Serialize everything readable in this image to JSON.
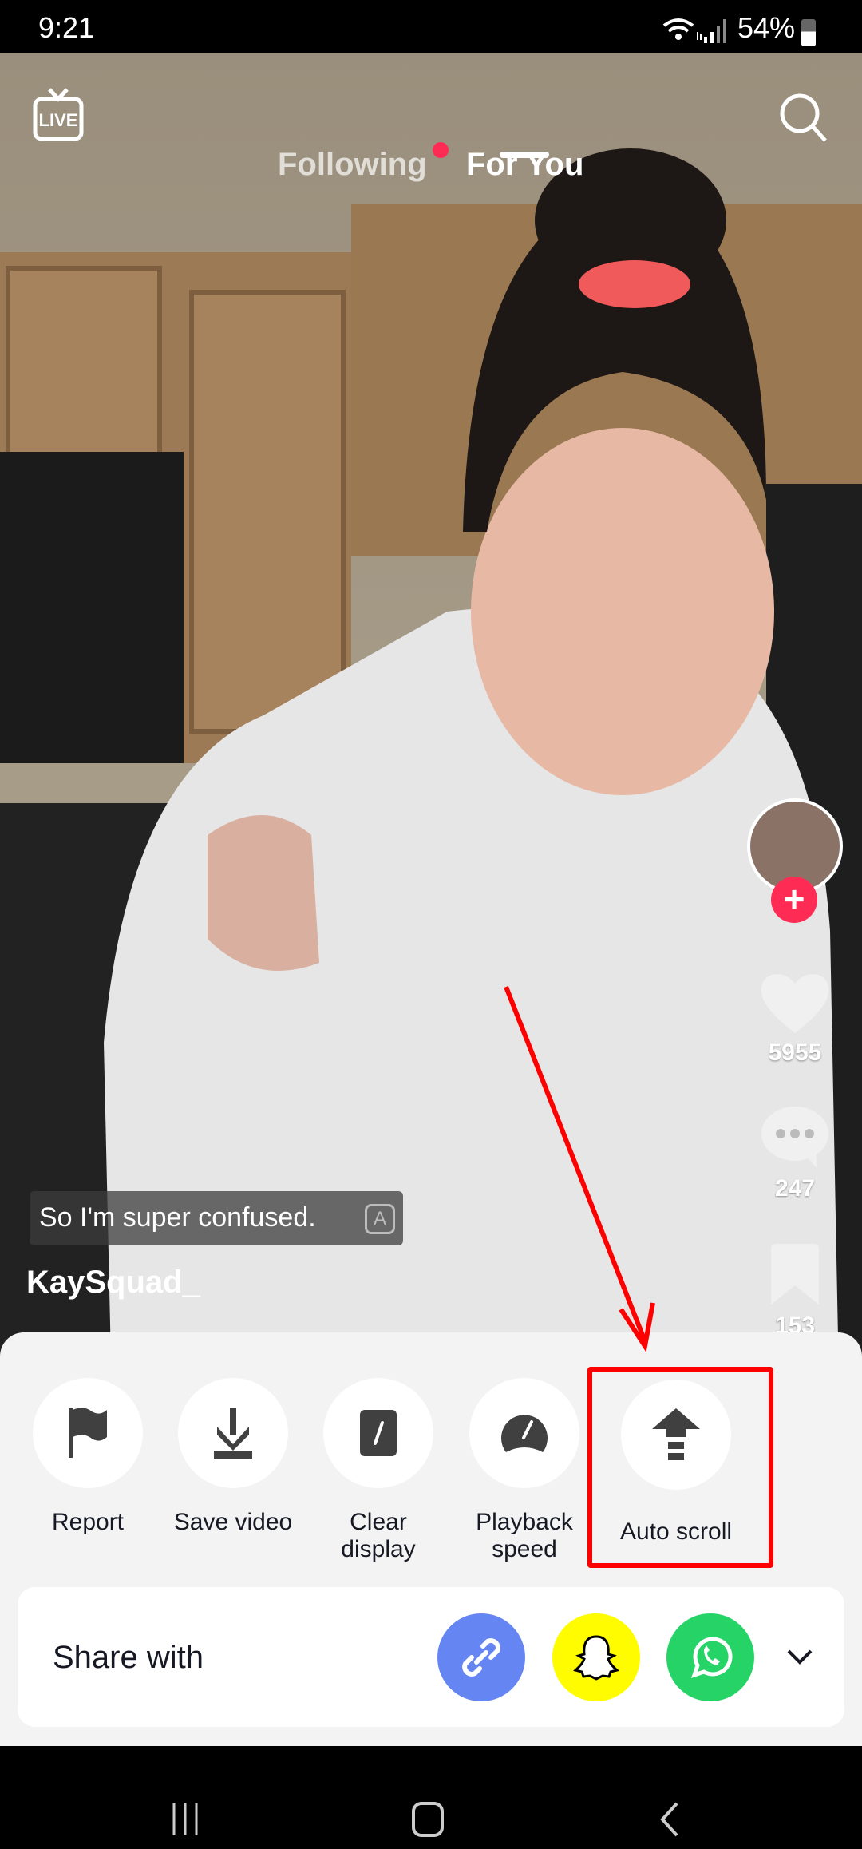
{
  "status_bar": {
    "time": "9:21",
    "battery": "54%",
    "icons": [
      "wifi-icon",
      "signal-icon",
      "battery-icon"
    ]
  },
  "top_nav": {
    "live_label": "LIVE",
    "tabs": [
      {
        "label": "Following",
        "active": false,
        "has_dot": true
      },
      {
        "label": "For You",
        "active": true
      }
    ],
    "search_icon": "search-icon"
  },
  "video": {
    "caption_overlay": "So I'm super confused.",
    "username": "KaySquad_"
  },
  "sidebar": {
    "likes": "5955",
    "comments": "247",
    "saves": "153"
  },
  "sheet": {
    "actions": [
      {
        "label": "Report",
        "icon": "flag-icon"
      },
      {
        "label": "Save video",
        "icon": "download-icon"
      },
      {
        "label": "Clear display",
        "icon": "clear-display-icon"
      },
      {
        "label": "Playback speed",
        "icon": "speedometer-icon"
      },
      {
        "label": "Auto scroll",
        "icon": "auto-scroll-icon",
        "highlighted": true
      }
    ],
    "share": {
      "label": "Share with",
      "targets": [
        {
          "icon": "link-icon",
          "color": "#6585f2"
        },
        {
          "icon": "snapchat-icon",
          "color": "#fffc00"
        },
        {
          "icon": "whatsapp-icon",
          "color": "#25d366"
        }
      ]
    }
  },
  "colors": {
    "accent": "#fe2c55",
    "annotation": "#ff0000",
    "sheet_bg": "#f3f3f3"
  }
}
